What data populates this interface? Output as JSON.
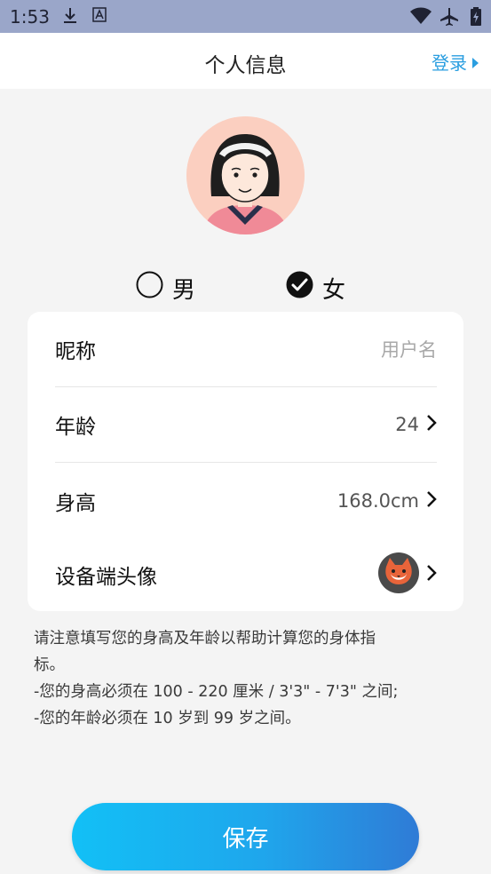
{
  "status_bar": {
    "time": "1:53"
  },
  "header": {
    "title": "个人信息",
    "login_label": "登录"
  },
  "gender": {
    "male_label": "男",
    "female_label": "女",
    "selected": "女"
  },
  "form": {
    "nickname": {
      "label": "昵称",
      "placeholder": "用户名"
    },
    "age": {
      "label": "年龄",
      "value": "24"
    },
    "height": {
      "label": "身高",
      "value": "168.0cm"
    },
    "device_avatar": {
      "label": "设备端头像"
    }
  },
  "note": {
    "lines": [
      "请注意填写您的身高及年龄以帮助计算您的身体指",
      "标。",
      "-您的身高必须在 100 - 220 厘米 / 3'3\" - 7'3\" 之间;",
      "-您的年龄必须在 10 岁到 99 岁之间。"
    ]
  },
  "save_label": "保存",
  "colors": {
    "accent": "#2a9ee0",
    "status_bar": "#9aa6c9",
    "avatar_bg": "#fbd0c1"
  }
}
